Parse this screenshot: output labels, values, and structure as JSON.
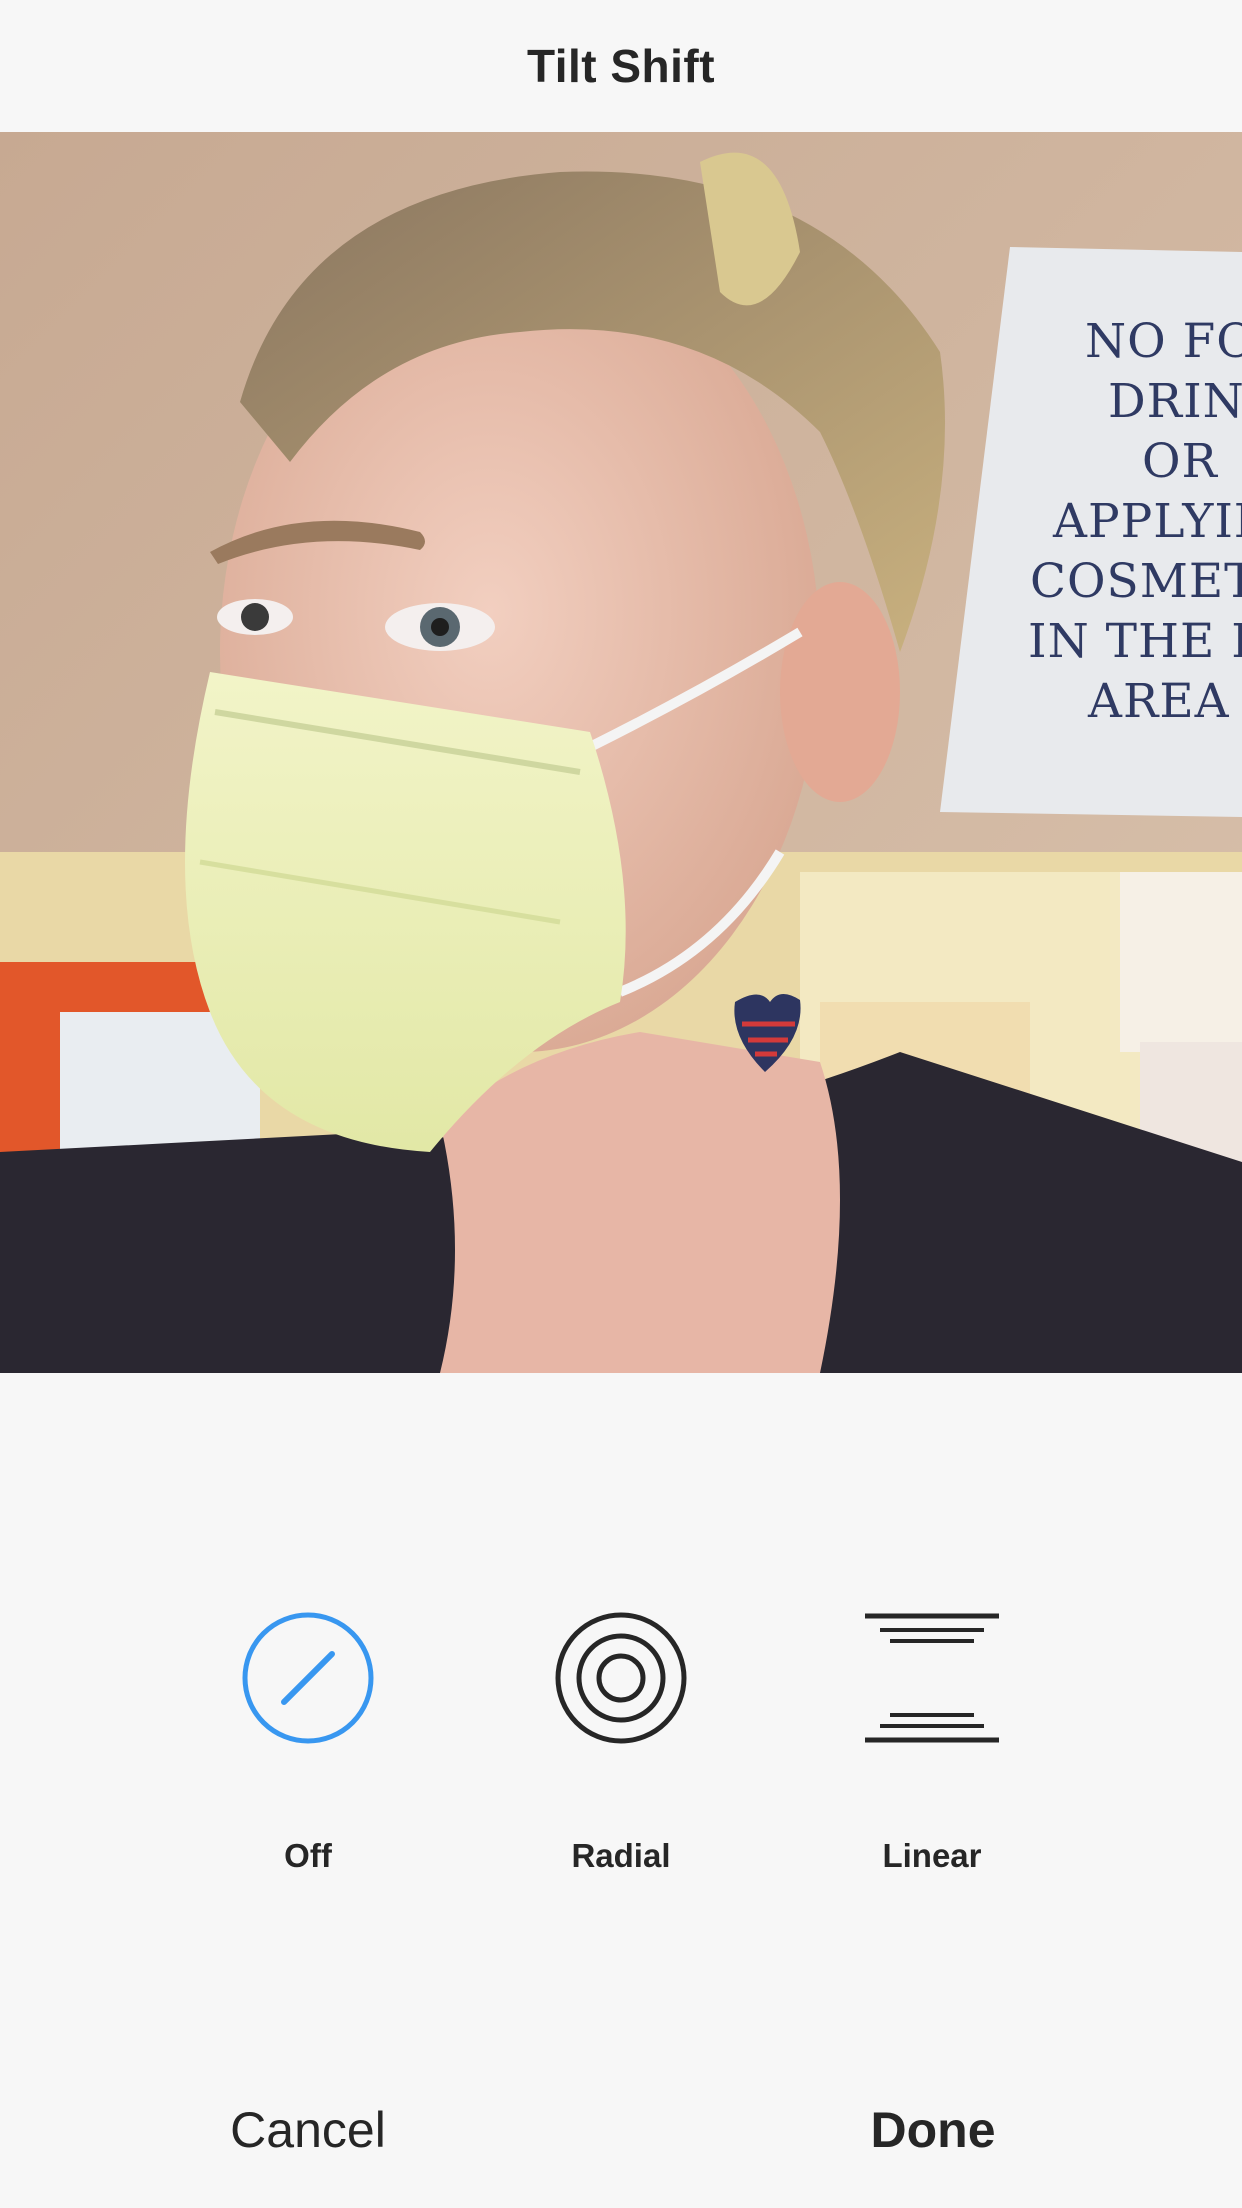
{
  "header": {
    "title": "Tilt Shift"
  },
  "photo": {
    "description_icon": "photo-preview",
    "sign_lines": [
      "NO FOOD",
      "DRINK",
      "OR",
      "APPLYING",
      "COSMETICS",
      "IN THE LAB",
      "AREA"
    ]
  },
  "tools": [
    {
      "label": "Off",
      "icon": "off-slash-circle-icon",
      "selected": true
    },
    {
      "label": "Radial",
      "icon": "radial-rings-icon",
      "selected": false
    },
    {
      "label": "Linear",
      "icon": "linear-lines-icon",
      "selected": false
    }
  ],
  "footer": {
    "cancel_label": "Cancel",
    "done_label": "Done"
  },
  "colors": {
    "accent": "#3897f0",
    "text": "#262626",
    "background": "#f7f7f7"
  }
}
